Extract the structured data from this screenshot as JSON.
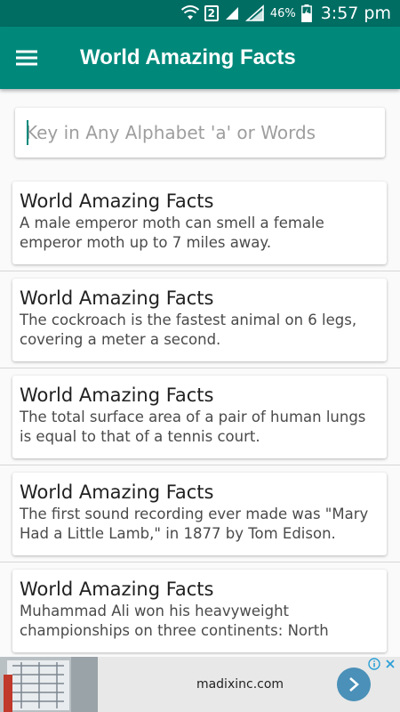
{
  "status_bar": {
    "sim_slot": "2",
    "battery_percent": "46%",
    "time": "3:57 pm"
  },
  "app_bar": {
    "title": "World Amazing Facts",
    "menu_icon": "hamburger-menu-icon"
  },
  "search": {
    "placeholder": "Key in Any Alphabet 'a' or Words",
    "value": ""
  },
  "facts": [
    {
      "title": "World Amazing Facts",
      "text": "A male emperor moth can smell a female emperor moth up to 7 miles away."
    },
    {
      "title": "World Amazing Facts",
      "text": "The cockroach is the fastest animal on 6 legs, covering a meter a second."
    },
    {
      "title": "World Amazing Facts",
      "text": "The total surface area of a pair of human lungs is equal to that of a tennis court."
    },
    {
      "title": "World Amazing Facts",
      "text": "The first sound recording ever made was \"Mary Had a Little Lamb,\" in 1877 by Tom Edison."
    },
    {
      "title": "World Amazing Facts",
      "text": "Muhammad Ali won his heavyweight championships on three continents: North"
    }
  ],
  "ad": {
    "domain": "madixinc.com"
  },
  "colors": {
    "primary": "#00897b",
    "primary_dark": "#006d63",
    "ad_button": "#4a90b8"
  }
}
